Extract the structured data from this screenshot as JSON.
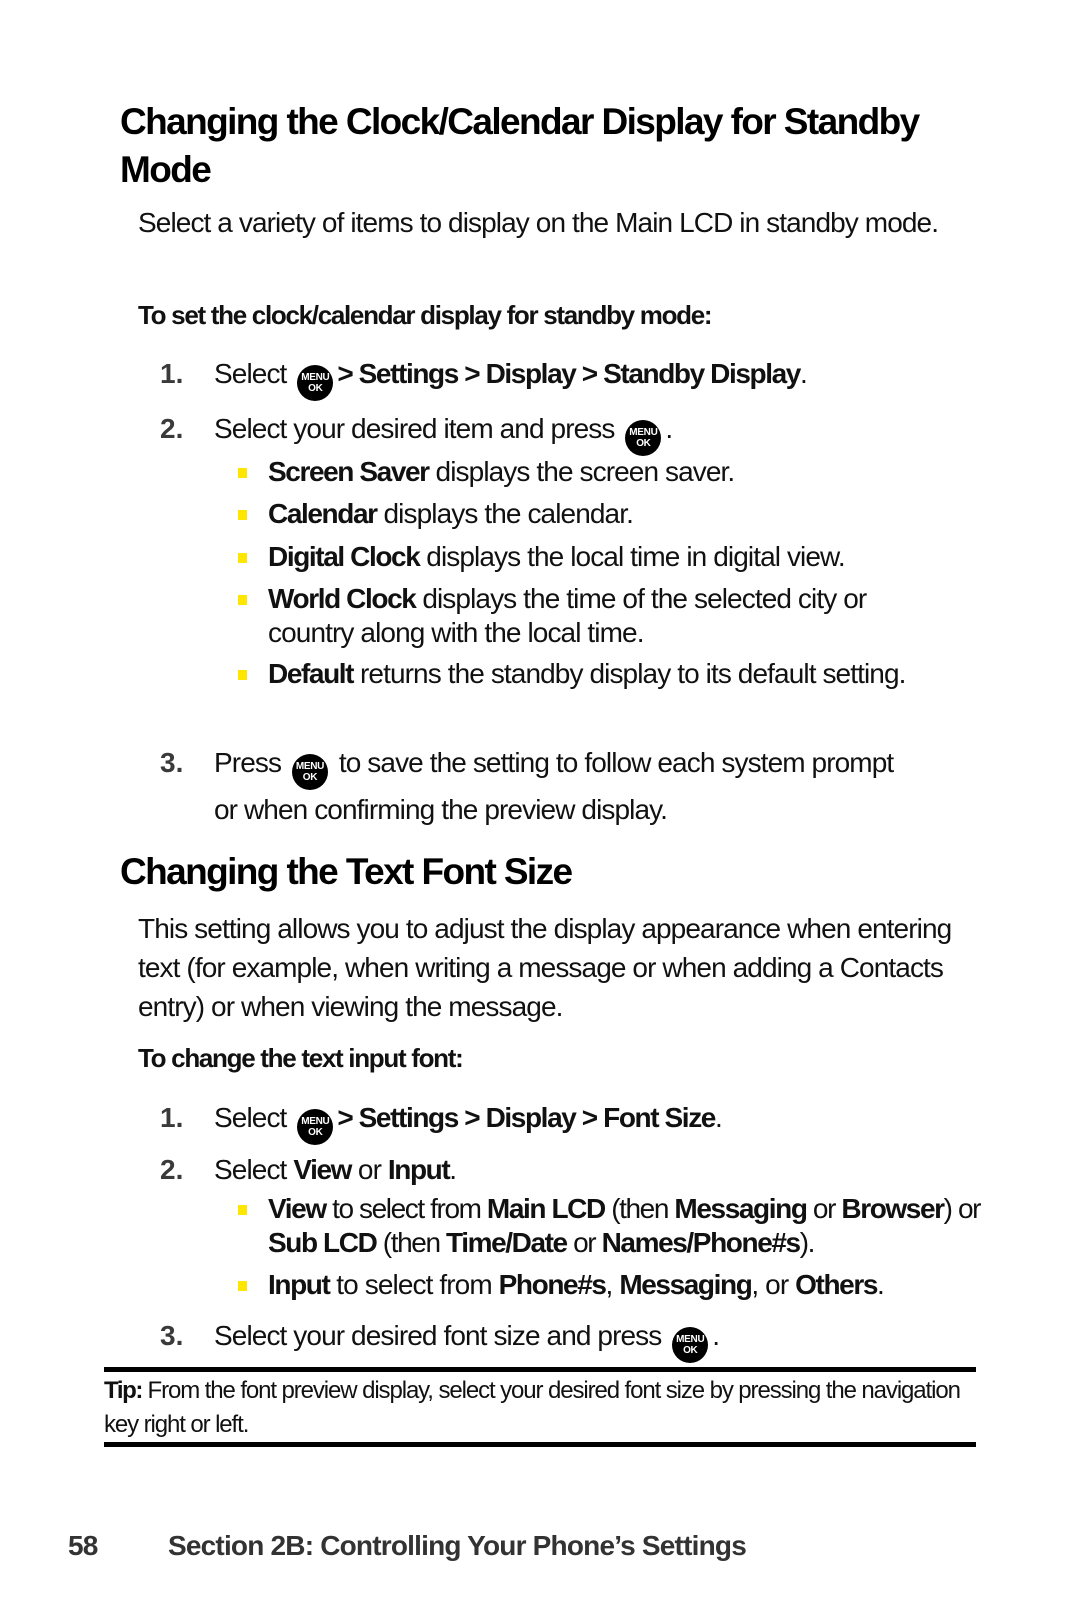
{
  "section1": {
    "title": "Changing the Clock/Calendar Display for Standby Mode",
    "intro": "Select a variety of items to display on the Main LCD in standby mode.",
    "subheading": "To set the clock/calendar display for standby mode:",
    "steps": [
      {
        "num": "1.",
        "pre": "Select",
        "path": "> Settings > Display > Standby Display",
        "post": "."
      },
      {
        "num": "2.",
        "pre": "Select your desired item and press",
        "post": "."
      },
      {
        "num": "3.",
        "pre": "Press",
        "post": "to save the setting to follow each system prompt or when confirming the preview display."
      }
    ],
    "bullets": [
      {
        "term": "Screen Saver",
        "text": " displays the screen saver."
      },
      {
        "term": "Calendar",
        "text": " displays the calendar."
      },
      {
        "term": "Digital Clock",
        "text": " displays the local time in digital view."
      },
      {
        "term": "World Clock",
        "text": " displays the time of the selected city or country along with the local time."
      },
      {
        "term": "Default",
        "text": " returns the standby display to its default setting."
      }
    ]
  },
  "section2": {
    "title": "Changing the Text Font Size",
    "intro": "This setting allows you to adjust the display appearance when entering text (for example, when writing a message or when adding a Contacts entry) or when viewing the message.",
    "subheading": "To change the text input font:",
    "steps": [
      {
        "num": "1.",
        "pre": "Select",
        "path": "> Settings > Display > Font Size",
        "post": "."
      },
      {
        "num": "2.",
        "pre": "Select ",
        "opt1": "View",
        "mid": " or ",
        "opt2": "Input",
        "post": "."
      },
      {
        "num": "3.",
        "pre": "Select your desired font size and press",
        "post": "."
      }
    ],
    "bullets": [
      {
        "parts": [
          "View",
          " to select from ",
          "Main LCD",
          " (then ",
          "Messaging",
          " or ",
          "Browser",
          ") or ",
          "Sub LCD",
          " (then ",
          "Time/Date",
          " or ",
          "Names/Phone#s",
          ")."
        ]
      },
      {
        "parts": [
          "Input",
          " to select from ",
          "Phone#s",
          ", ",
          "Messaging",
          ", or ",
          "Others",
          "."
        ]
      }
    ]
  },
  "menu_key": {
    "icon": "menu-ok-key-icon",
    "line1": "MENU",
    "line2": "OK"
  },
  "tip": {
    "label": "Tip:",
    "text": " From the font preview display, select your desired font size by pressing the navigation key right or left."
  },
  "footer": {
    "page_number": "58",
    "section": "Section 2B: Controlling Your Phone’s Settings"
  },
  "colors": {
    "bullet": "#FFE600",
    "step_number": "#3a3a3a"
  }
}
